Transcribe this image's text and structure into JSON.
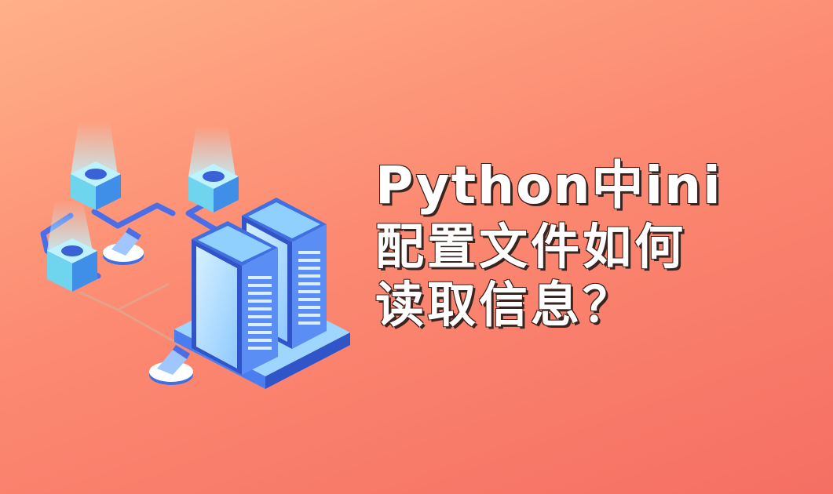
{
  "title": {
    "line1": "Python中ini",
    "line2": "配置文件如何",
    "line3": "读取信息？"
  },
  "colors": {
    "background_top": "#ffb088",
    "background_bottom": "#f56f63",
    "server_blue": "#3f6fe0",
    "server_light": "#9fd6ff",
    "node_cyan": "#8fe4f5",
    "text": "#ffffff"
  },
  "icons": [
    "server-rack-icon",
    "network-node-icon",
    "connector-cable-icon"
  ]
}
